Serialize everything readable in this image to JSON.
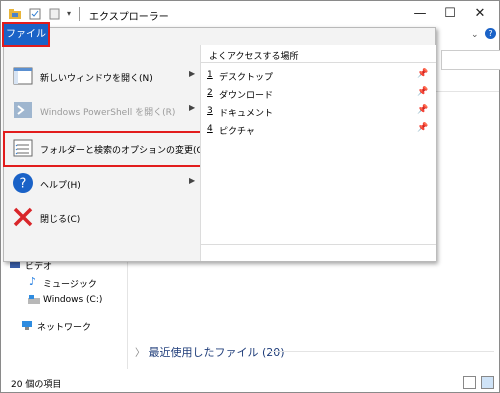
{
  "window": {
    "title": "エクスプローラー"
  },
  "file_menu": {
    "tab_label": "ファイル",
    "items": [
      {
        "label": "新しいウィンドウを開く(N)",
        "submenu": true,
        "disabled": false
      },
      {
        "label": "Windows PowerShell を開く(R)",
        "submenu": true,
        "disabled": true
      },
      {
        "label": "フォルダーと検索のオプションの変更(O)",
        "submenu": false,
        "disabled": false,
        "highlighted": true
      },
      {
        "label": "ヘルプ(H)",
        "submenu": true,
        "disabled": false
      },
      {
        "label": "閉じる(C)",
        "submenu": false,
        "disabled": false
      }
    ],
    "frequent_title": "よくアクセスする場所",
    "frequent": [
      {
        "num": "1",
        "name": "デスクトップ"
      },
      {
        "num": "2",
        "name": "ダウンロード"
      },
      {
        "num": "3",
        "name": "ドキュメント"
      },
      {
        "num": "4",
        "name": "ピクチャ"
      }
    ]
  },
  "nav": {
    "items": [
      {
        "label": "ビデオ"
      },
      {
        "label": "ミュージック"
      },
      {
        "label": "Windows (C:)"
      },
      {
        "label": "ネットワーク"
      }
    ]
  },
  "content": {
    "recent_label": "最近使用したファイル (20)"
  },
  "status": {
    "text": "20 個の項目"
  },
  "colors": {
    "accent": "#1a62c7",
    "highlight": "#e21c1c"
  }
}
